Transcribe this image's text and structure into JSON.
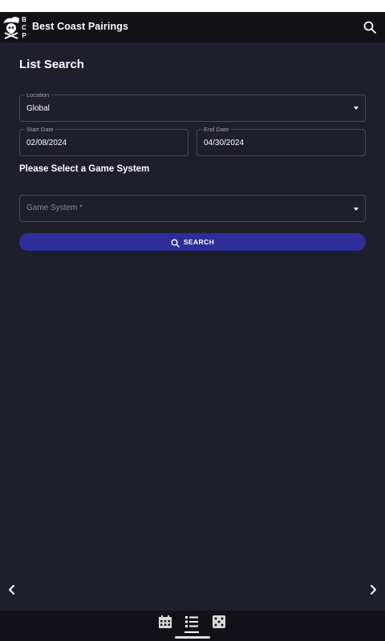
{
  "app": {
    "title": "Best Coast Pairings",
    "logo_letters": "BCP"
  },
  "page": {
    "title": "List Search",
    "section_title": "Please Select a Game System"
  },
  "form": {
    "location": {
      "label": "Location",
      "value": "Global"
    },
    "start_date": {
      "label": "Start Date",
      "value": "02/08/2024"
    },
    "end_date": {
      "label": "End Date",
      "value": "04/30/2024"
    },
    "game_system": {
      "placeholder": "Game System *"
    }
  },
  "search_button": {
    "label": "SEARCH",
    "icon": "search-icon"
  },
  "bottom_nav": {
    "items": [
      {
        "icon": "calendar-icon",
        "active": false
      },
      {
        "icon": "list-icon",
        "active": true
      },
      {
        "icon": "dice-icon",
        "active": false
      }
    ]
  },
  "colors": {
    "background": "#1f1f2b",
    "bar": "#111117",
    "accent": "#2e2e9a",
    "border": "#4a4a57"
  }
}
